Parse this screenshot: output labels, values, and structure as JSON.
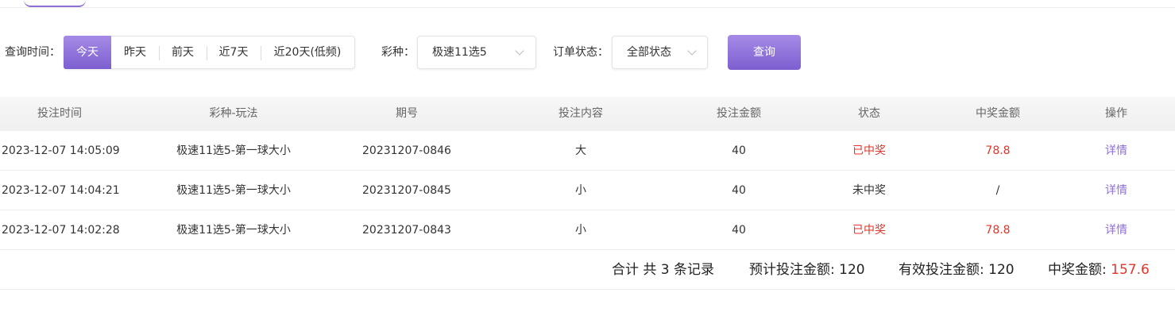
{
  "filters": {
    "time_label": "查询时间：",
    "time_options": [
      "今天",
      "昨天",
      "前天",
      "近7天",
      "近20天(低频)"
    ],
    "lottery_label": "彩种：",
    "lottery_value": "极速11选5",
    "status_label": "订单状态：",
    "status_value": "全部状态",
    "query_label": "查询"
  },
  "table": {
    "headers": [
      "投注时间",
      "彩种-玩法",
      "期号",
      "投注内容",
      "投注金额",
      "状态",
      "中奖金额",
      "操作"
    ],
    "rows": [
      {
        "time": "2023-12-07 14:05:09",
        "game": "极速11选5-第一球大小",
        "issue": "20231207-0846",
        "content": "大",
        "amount": "40",
        "status": "已中奖",
        "win": "78.8",
        "action": "详情"
      },
      {
        "time": "2023-12-07 14:04:21",
        "game": "极速11选5-第一球大小",
        "issue": "20231207-0845",
        "content": "小",
        "amount": "40",
        "status": "未中奖",
        "win": "/",
        "action": "详情"
      },
      {
        "time": "2023-12-07 14:02:28",
        "game": "极速11选5-第一球大小",
        "issue": "20231207-0843",
        "content": "小",
        "amount": "40",
        "status": "已中奖",
        "win": "78.8",
        "action": "详情"
      }
    ]
  },
  "summary": {
    "total": "合计 共 3 条记录",
    "expected_label": "预计投注金额: 120",
    "valid_label": "有效投注金额: 120",
    "win_label": "中奖金额: ",
    "win_value": "157.6"
  },
  "colors": {
    "accent": "#8e6fd6",
    "win": "#e2352b"
  }
}
